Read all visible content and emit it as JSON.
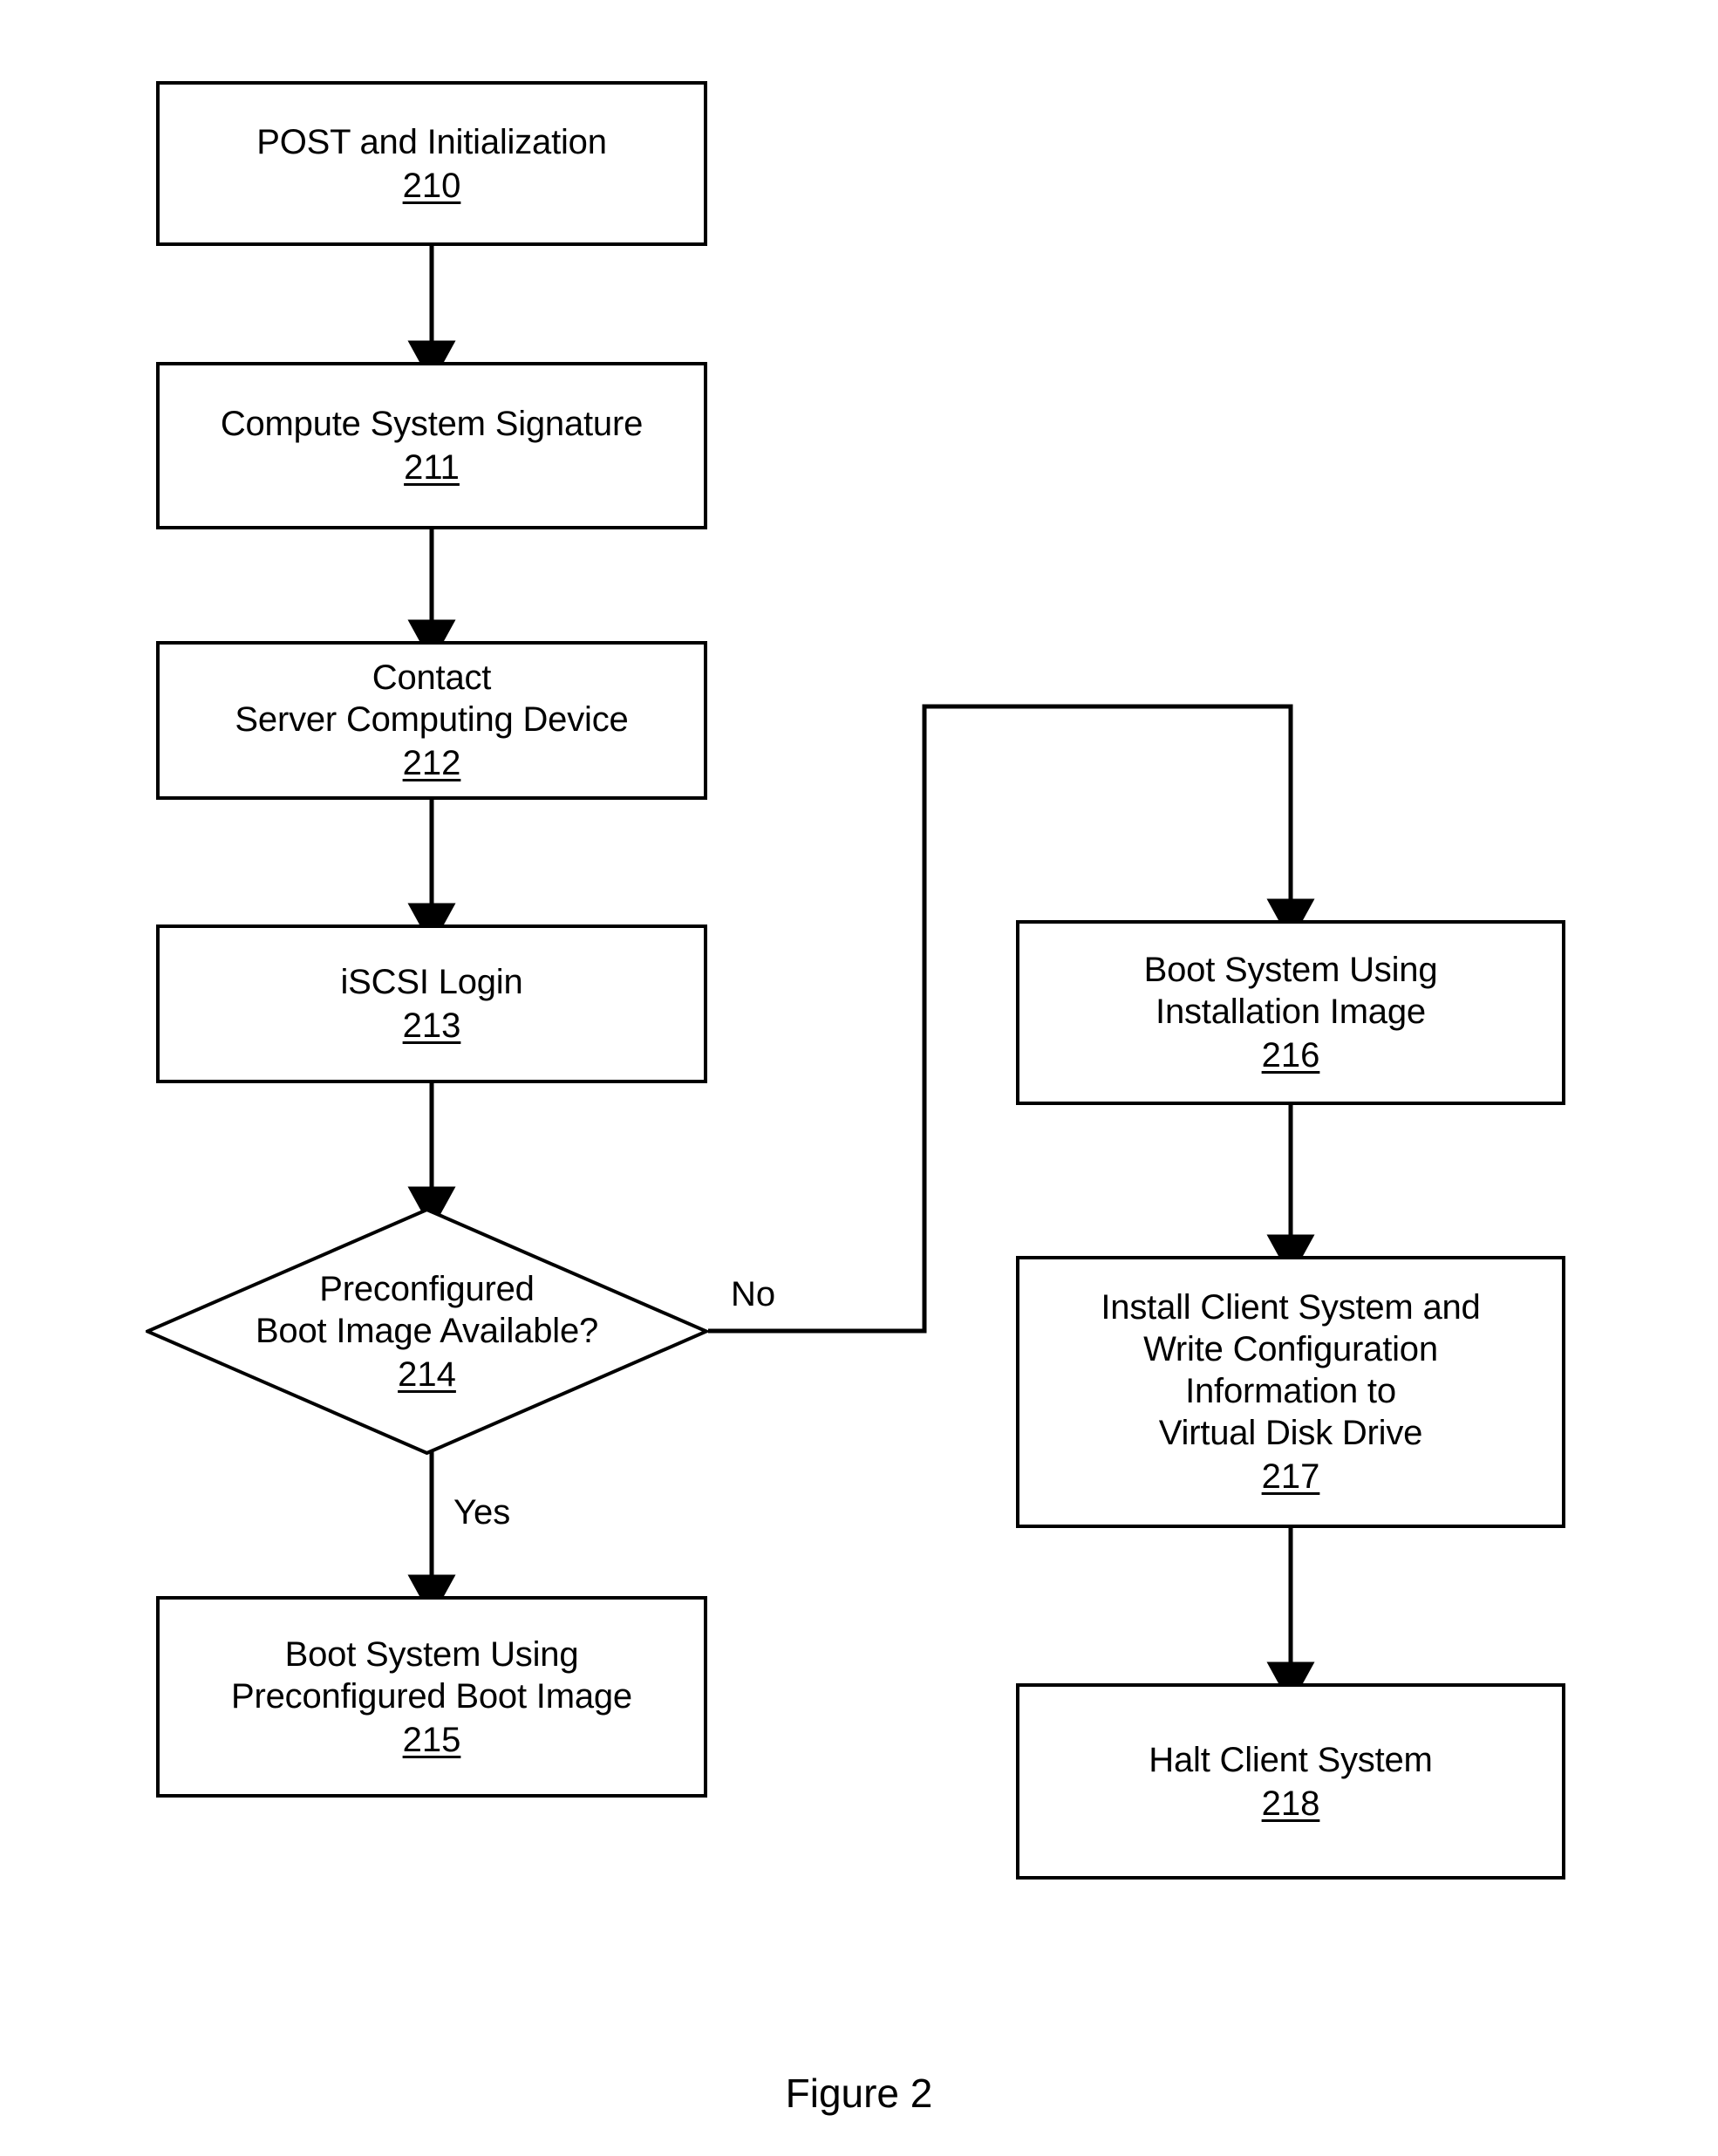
{
  "figure": {
    "caption": "Figure 2"
  },
  "nodes": [
    {
      "id": "post-and-initialization",
      "label": "POST and Initialization",
      "ref": "210",
      "shape": "process"
    },
    {
      "id": "compute-system-signature",
      "label": "Compute System Signature",
      "ref": "211",
      "shape": "process"
    },
    {
      "id": "contact-server-computing-device",
      "label": "Contact\nServer Computing Device",
      "ref": "212",
      "shape": "process"
    },
    {
      "id": "iscsi-login",
      "label": "iSCSI Login",
      "ref": "213",
      "shape": "process"
    },
    {
      "id": "preconfigured-boot-image-available",
      "label": "Preconfigured\nBoot Image Available?",
      "ref": "214",
      "shape": "decision"
    },
    {
      "id": "boot-system-using-preconfigured-boot-image",
      "label": "Boot System Using\nPreconfigured Boot Image",
      "ref": "215",
      "shape": "process"
    },
    {
      "id": "boot-system-using-installation-image",
      "label": "Boot System Using\nInstallation Image",
      "ref": "216",
      "shape": "process"
    },
    {
      "id": "install-client-system-and-write-configuration",
      "label": "Install Client System and\nWrite Configuration\nInformation to\nVirtual Disk Drive",
      "ref": "217",
      "shape": "process"
    },
    {
      "id": "halt-client-system",
      "label": "Halt Client System",
      "ref": "218",
      "shape": "process"
    }
  ],
  "edge_labels": {
    "decision_no": "No",
    "decision_yes": "Yes"
  },
  "colors": {
    "stroke": "#000000",
    "fill": "#ffffff",
    "text": "#000000"
  }
}
